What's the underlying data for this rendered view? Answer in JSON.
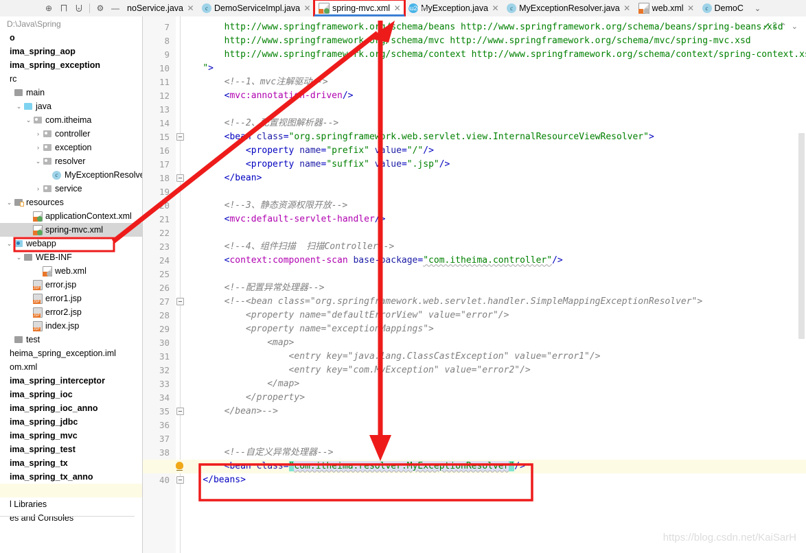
{
  "toolbar": {
    "icons": [
      {
        "name": "locate-icon",
        "glyph": "⊕"
      },
      {
        "name": "expand-all-icon",
        "glyph": "⨅"
      },
      {
        "name": "collapse-all-icon",
        "glyph": "⨄"
      },
      {
        "name": "settings-gear-icon",
        "glyph": "⚙"
      },
      {
        "name": "hide-icon",
        "glyph": "—"
      }
    ]
  },
  "tabs": [
    {
      "label": "noService.java",
      "icon": "java-class-icon",
      "icon_kind": "none",
      "active": false,
      "highlighted": false
    },
    {
      "label": "DemoServiceImpl.java",
      "icon": "java-class-icon",
      "icon_kind": "class",
      "active": false,
      "highlighted": false
    },
    {
      "label": "spring-mvc.xml",
      "icon": "spring-xml-icon",
      "icon_kind": "xml",
      "active": true,
      "highlighted": true
    },
    {
      "label": "MyException.java",
      "icon": "java-exception-icon",
      "icon_kind": "lightning",
      "active": false,
      "highlighted": false
    },
    {
      "label": "MyExceptionResolver.java",
      "icon": "java-class-icon",
      "icon_kind": "class",
      "active": false,
      "highlighted": false
    },
    {
      "label": "web.xml",
      "icon": "xml-icon",
      "icon_kind": "xmlgray",
      "active": false,
      "highlighted": false
    },
    {
      "label": "DemoC",
      "icon": "java-class-icon",
      "icon_kind": "class",
      "active": false,
      "highlighted": false
    }
  ],
  "tab_overflow_chevron": "⌄",
  "tab_close_glyph": "✕",
  "sidebar": {
    "path": "D:\\Java\\Spring",
    "items": [
      {
        "label": "o",
        "indent": 0,
        "arrow": "",
        "icon": "none",
        "bold": true,
        "truncated_left": true
      },
      {
        "label": "ima_spring_aop",
        "indent": 0,
        "arrow": "",
        "icon": "none",
        "bold": true,
        "truncated_left": true
      },
      {
        "label": "ima_spring_exception",
        "indent": 0,
        "arrow": "",
        "icon": "none",
        "bold": true,
        "truncated_left": true
      },
      {
        "label": "rc",
        "indent": 0,
        "arrow": "",
        "icon": "none",
        "bold": false,
        "truncated_left": true
      },
      {
        "label": "main",
        "indent": 0,
        "arrow": "",
        "icon": "folder-gray",
        "bold": false
      },
      {
        "label": "java",
        "indent": 1,
        "arrow": "⌄",
        "icon": "folder-source",
        "bold": false
      },
      {
        "label": "com.itheima",
        "indent": 2,
        "arrow": "⌄",
        "icon": "package",
        "bold": false
      },
      {
        "label": "controller",
        "indent": 3,
        "arrow": "›",
        "icon": "package",
        "bold": false
      },
      {
        "label": "exception",
        "indent": 3,
        "arrow": "›",
        "icon": "package",
        "bold": false
      },
      {
        "label": "resolver",
        "indent": 3,
        "arrow": "⌄",
        "icon": "package",
        "bold": false
      },
      {
        "label": "MyExceptionResolver",
        "indent": 4,
        "arrow": "",
        "icon": "class",
        "bold": false
      },
      {
        "label": "service",
        "indent": 3,
        "arrow": "›",
        "icon": "package",
        "bold": false
      },
      {
        "label": "resources",
        "indent": 0,
        "arrow": "⌄",
        "icon": "folder-resources",
        "bold": false
      },
      {
        "label": "applicationContext.xml",
        "indent": 2,
        "arrow": "",
        "icon": "xml",
        "bold": false
      },
      {
        "label": "spring-mvc.xml",
        "indent": 2,
        "arrow": "",
        "icon": "xml",
        "bold": false,
        "selected": true,
        "highlighted": true
      },
      {
        "label": "webapp",
        "indent": 0,
        "arrow": "⌄",
        "icon": "folder-web",
        "bold": false
      },
      {
        "label": "WEB-INF",
        "indent": 1,
        "arrow": "⌄",
        "icon": "folder-gray",
        "bold": false
      },
      {
        "label": "web.xml",
        "indent": 3,
        "arrow": "",
        "icon": "xmlgray",
        "bold": false
      },
      {
        "label": "error.jsp",
        "indent": 2,
        "arrow": "",
        "icon": "jsp",
        "bold": false
      },
      {
        "label": "error1.jsp",
        "indent": 2,
        "arrow": "",
        "icon": "jsp",
        "bold": false
      },
      {
        "label": "error2.jsp",
        "indent": 2,
        "arrow": "",
        "icon": "jsp",
        "bold": false
      },
      {
        "label": "index.jsp",
        "indent": 2,
        "arrow": "",
        "icon": "jsp",
        "bold": false
      },
      {
        "label": "test",
        "indent": 0,
        "arrow": "",
        "icon": "folder-gray",
        "bold": false
      },
      {
        "label": "heima_spring_exception.iml",
        "indent": 0,
        "arrow": "",
        "icon": "none",
        "bold": false,
        "truncated_left": true
      },
      {
        "label": "om.xml",
        "indent": 0,
        "arrow": "",
        "icon": "none",
        "bold": false,
        "truncated_left": true
      },
      {
        "label": "ima_spring_interceptor",
        "indent": 0,
        "arrow": "",
        "icon": "none",
        "bold": true,
        "truncated_left": true
      },
      {
        "label": "ima_spring_ioc",
        "indent": 0,
        "arrow": "",
        "icon": "none",
        "bold": true,
        "truncated_left": true
      },
      {
        "label": "ima_spring_ioc_anno",
        "indent": 0,
        "arrow": "",
        "icon": "none",
        "bold": true,
        "truncated_left": true
      },
      {
        "label": "ima_spring_jdbc",
        "indent": 0,
        "arrow": "",
        "icon": "none",
        "bold": true,
        "truncated_left": true
      },
      {
        "label": "ima_spring_mvc",
        "indent": 0,
        "arrow": "",
        "icon": "none",
        "bold": true,
        "truncated_left": true
      },
      {
        "label": "ima_spring_test",
        "indent": 0,
        "arrow": "",
        "icon": "none",
        "bold": true,
        "truncated_left": true
      },
      {
        "label": "ima_spring_tx",
        "indent": 0,
        "arrow": "",
        "icon": "none",
        "bold": true,
        "truncated_left": true
      },
      {
        "label": "ima_spring_tx_anno",
        "indent": 0,
        "arrow": "",
        "icon": "none",
        "bold": true,
        "truncated_left": true
      },
      {
        "label": "",
        "indent": 0,
        "arrow": "",
        "icon": "none",
        "bold": false,
        "current": true
      },
      {
        "label": "l Libraries",
        "indent": 0,
        "arrow": "",
        "icon": "none",
        "bold": false,
        "truncated_left": true
      },
      {
        "label": "es and Consoles",
        "indent": 0,
        "arrow": "",
        "icon": "none",
        "bold": false,
        "truncated_left": true
      }
    ]
  },
  "editor": {
    "first_line_number": 7,
    "last_line_number": 40,
    "current_line": 39,
    "inspection": {
      "count": "2",
      "check_glyph": "✔",
      "up_glyph": "⌃",
      "down_glyph": "⌄"
    },
    "lines": [
      {
        "n": 7,
        "html": "        <span class='st'>http://www.springframework.org/schema/beans http://www.springframework.org/schema/beans/spring-beans.xsd</span>"
      },
      {
        "n": 8,
        "html": "        <span class='st'>http://www.springframework.org/schema/mvc http://www.springframework.org/schema/mvc/spring-mvc.xsd</span>"
      },
      {
        "n": 9,
        "html": "        <span class='st'>http://www.springframework.org/schema/context http://www.springframework.org/schema/context/spring-context.xsd</span>"
      },
      {
        "n": 10,
        "html": "    <span class='st'>\"</span><span class='tg'>></span>"
      },
      {
        "n": 11,
        "html": "        <span class='cm'>&lt;!--1、mvc注解驱动--&gt;</span>"
      },
      {
        "n": 12,
        "html": "        <span class='tg'>&lt;</span><span class='ns'>mvc:annotation-driven</span><span class='tg'>/&gt;</span>"
      },
      {
        "n": 13,
        "html": ""
      },
      {
        "n": 14,
        "html": "        <span class='cm'>&lt;!--2、配置视图解析器--&gt;</span>"
      },
      {
        "n": 15,
        "html": "        <span class='tg'>&lt;bean</span> <span class='at'>class</span><span class='tg'>=</span><span class='st'>\"org.springframework.web.servlet.view.InternalResourceViewResolver\"</span><span class='tg'>&gt;</span>"
      },
      {
        "n": 16,
        "html": "            <span class='tg'>&lt;property</span> <span class='at'>name</span><span class='tg'>=</span><span class='st'>\"prefix\"</span> <span class='at'>value</span><span class='tg'>=</span><span class='st'>\"/\"</span><span class='tg'>/&gt;</span>"
      },
      {
        "n": 17,
        "html": "            <span class='tg'>&lt;property</span> <span class='at'>name</span><span class='tg'>=</span><span class='st'>\"suffix\"</span> <span class='at'>value</span><span class='tg'>=</span><span class='st'>\".jsp\"</span><span class='tg'>/&gt;</span>"
      },
      {
        "n": 18,
        "html": "        <span class='tg'>&lt;/bean&gt;</span>"
      },
      {
        "n": 19,
        "html": ""
      },
      {
        "n": 20,
        "html": "        <span class='cm'>&lt;!--3、静态资源权限开放--&gt;</span>"
      },
      {
        "n": 21,
        "html": "        <span class='tg'>&lt;</span><span class='ns'>mvc:default-servlet-handler</span><span class='tg'>/&gt;</span>"
      },
      {
        "n": 22,
        "html": ""
      },
      {
        "n": 23,
        "html": "        <span class='cm'>&lt;!--4、组件扫描  扫描Controller--&gt;</span>"
      },
      {
        "n": 24,
        "html": "        <span class='tg'>&lt;</span><span class='ns'>context:component-scan</span> <span class='at'>base-package</span><span class='tg'>=</span><span class='st sq'>\"com.itheima.controller\"</span><span class='tg'>/&gt;</span>"
      },
      {
        "n": 25,
        "html": ""
      },
      {
        "n": 26,
        "html": "        <span class='cm'>&lt;!--配置异常处理器--&gt;</span>"
      },
      {
        "n": 27,
        "html": "        <span class='cm'>&lt;!--&lt;bean class=\"org.springframework.web.servlet.handler.SimpleMappingExceptionResolver\"&gt;</span>"
      },
      {
        "n": 28,
        "html": "            <span class='cm'>&lt;property name=\"defaultErrorView\" value=\"error\"/&gt;</span>"
      },
      {
        "n": 29,
        "html": "            <span class='cm'>&lt;property name=\"exceptionMappings\"&gt;</span>"
      },
      {
        "n": 30,
        "html": "                <span class='cm'>&lt;map&gt;</span>"
      },
      {
        "n": 31,
        "html": "                    <span class='cm'>&lt;entry key=\"java.lang.ClassCastException\" value=\"error1\"/&gt;</span>"
      },
      {
        "n": 32,
        "html": "                    <span class='cm'>&lt;entry key=\"com.MyException\" value=\"error2\"/&gt;</span>"
      },
      {
        "n": 33,
        "html": "                <span class='cm'>&lt;/map&gt;</span>"
      },
      {
        "n": 34,
        "html": "            <span class='cm'>&lt;/property&gt;</span>"
      },
      {
        "n": 35,
        "html": "        <span class='cm'>&lt;/bean&gt;--&gt;</span>"
      },
      {
        "n": 36,
        "html": ""
      },
      {
        "n": 37,
        "html": ""
      },
      {
        "n": 38,
        "html": "        <span class='cm'>&lt;!--自定义异常处理器--&gt;</span>"
      },
      {
        "n": 39,
        "html": "        <span class='tg'>&lt;bean</span> <span class='at'>class</span><span class='tg'>=</span><span class='hlbrace st'>\"</span><span class='hl st sq'>com.itheima.resolver.MyExceptionResolver</span><span class='hlbrace st'>\"</span><span class='tg'>/&gt;</span>"
      },
      {
        "n": 40,
        "html": "    <span class='tg'>&lt;/beans&gt;</span>"
      }
    ],
    "code_text": {
      "line7": "http://www.springframework.org/schema/beans http://www.springframework.org/schema/beans/spring-beans.xsd",
      "line8": "http://www.springframework.org/schema/mvc http://www.springframework.org/schema/mvc/spring-mvc.xsd",
      "line9": "http://www.springframework.org/schema/context http://www.springframework.org/schema/context/spring-context.xsd",
      "line10": "\">",
      "line11": "<!--1、mvc注解驱动-->",
      "line12": "<mvc:annotation-driven/>",
      "line14": "<!--2、配置视图解析器-->",
      "line15": "<bean class=\"org.springframework.web.servlet.view.InternalResourceViewResolver\">",
      "line16": "<property name=\"prefix\" value=\"/\"/>",
      "line17": "<property name=\"suffix\" value=\".jsp\"/>",
      "line18": "</bean>",
      "line20": "<!--3、静态资源权限开放-->",
      "line21": "<mvc:default-servlet-handler/>",
      "line23": "<!--4、组件扫描  扫描Controller-->",
      "line24": "<context:component-scan base-package=\"com.itheima.controller\"/>",
      "line26": "<!--配置异常处理器-->",
      "line27": "<!--<bean class=\"org.springframework.web.servlet.handler.SimpleMappingExceptionResolver\">",
      "line28": "<property name=\"defaultErrorView\" value=\"error\"/>",
      "line29": "<property name=\"exceptionMappings\">",
      "line30": "<map>",
      "line31": "<entry key=\"java.lang.ClassCastException\" value=\"error1\"/>",
      "line32": "<entry key=\"com.MyException\" value=\"error2\"/>",
      "line33": "</map>",
      "line34": "</property>",
      "line35": "</bean>-->",
      "line38": "<!--自定义异常处理器-->",
      "line39": "<bean class=\"com.itheima.resolver.MyExceptionResolver\"/>",
      "line40": "</beans>"
    }
  },
  "annotations": {
    "arrow_color": "#ee1b1b",
    "box_color": "#ee1b1b",
    "description": "red arrows pointing from sidebar spring-mvc.xml to the tab, and from the tab down to the highlighted bean line"
  },
  "watermark": "https://blog.csdn.net/KaiSarH",
  "colors": {
    "accent": "#3b7fd4",
    "annotation": "#ee1b1b",
    "string": "#008000",
    "tag": "#0000c0",
    "comment": "#808080",
    "namespace": "#b000b0",
    "selection": "#d6d6d6",
    "current_line": "#fdfbe4"
  }
}
